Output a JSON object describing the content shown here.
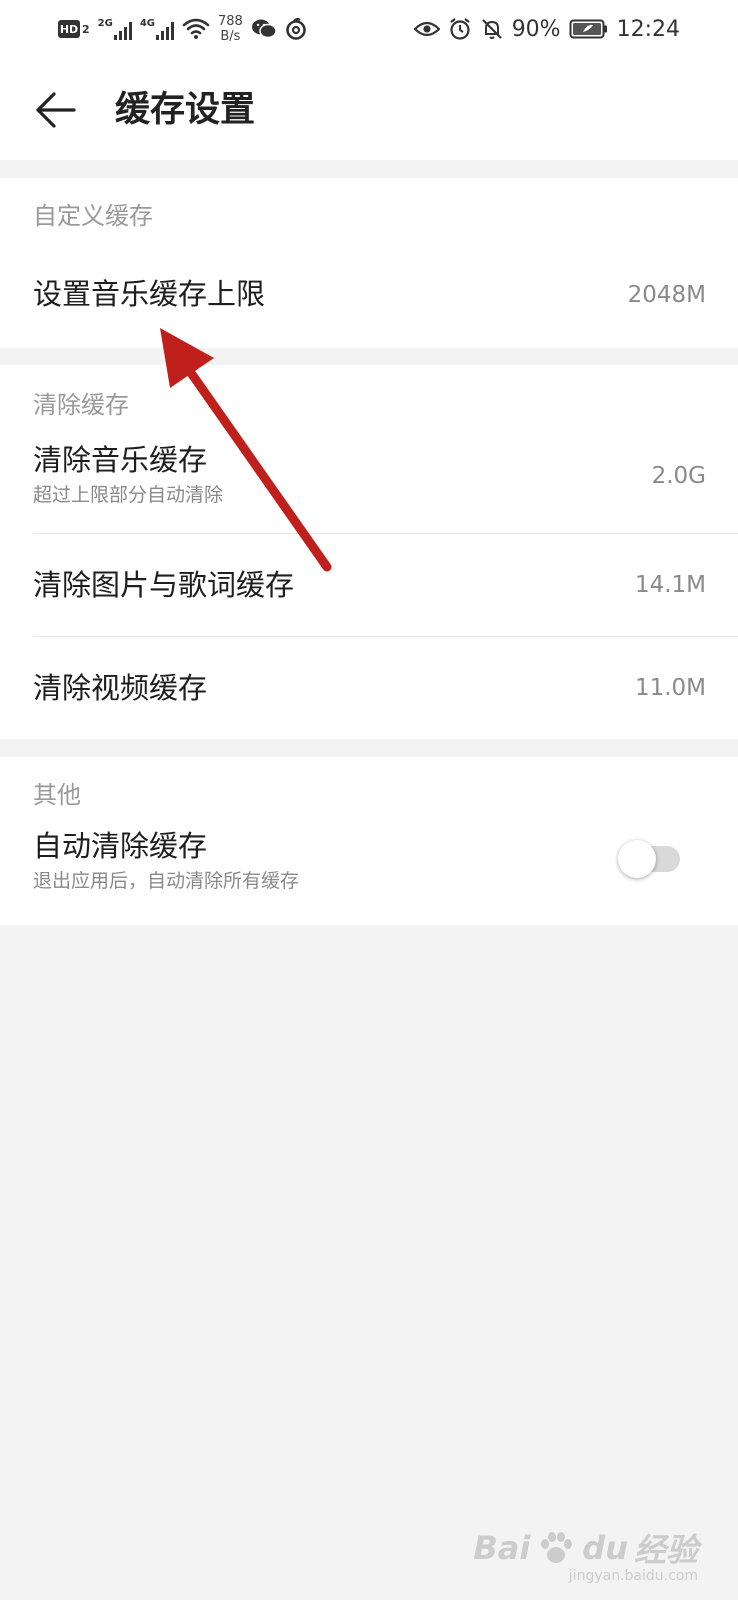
{
  "status_bar": {
    "hd_badge": "HD",
    "hd_sub": "2",
    "net1_label": "2G",
    "net2_label": "4G",
    "speed_value": "788",
    "speed_unit": "B/s",
    "battery_percent": "90%",
    "time": "12:24",
    "icons": [
      "hd-icon",
      "signal-2g-icon",
      "signal-4g-icon",
      "wifi-icon",
      "wechat-icon",
      "netease-music-icon",
      "eye-icon",
      "alarm-icon",
      "bell-muted-icon",
      "battery-icon"
    ]
  },
  "header": {
    "title": "缓存设置",
    "back_icon": "arrow-left-icon"
  },
  "sections": {
    "custom": {
      "title": "自定义缓存",
      "rows": [
        {
          "label": "设置音乐缓存上限",
          "value": "2048M"
        }
      ]
    },
    "clear": {
      "title": "清除缓存",
      "rows": [
        {
          "label": "清除音乐缓存",
          "subtitle": "超过上限部分自动清除",
          "value": "2.0G"
        },
        {
          "label": "清除图片与歌词缓存",
          "value": "14.1M"
        },
        {
          "label": "清除视频缓存",
          "value": "11.0M"
        }
      ]
    },
    "other": {
      "title": "其他",
      "rows": [
        {
          "label": "自动清除缓存",
          "subtitle": "退出应用后，自动清除所有缓存",
          "toggle_on": false
        }
      ]
    }
  },
  "annotation": {
    "color": "#c0201b",
    "points_to": "设置音乐缓存上限"
  },
  "watermark": {
    "text_latin": "Bai",
    "text_latin2": "du",
    "text_cn": "经验",
    "url": "jingyan.baidu.com"
  },
  "colors": {
    "background": "#f3f3f3",
    "card": "#ffffff",
    "toggle_off": "#d9d9d9"
  }
}
